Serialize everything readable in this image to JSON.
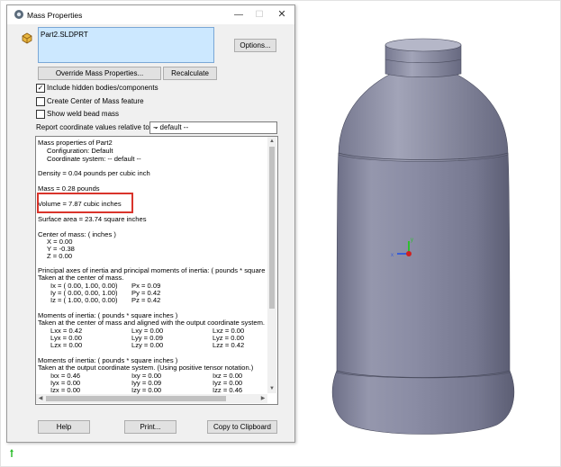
{
  "window": {
    "title": "Mass Properties",
    "minimize_glyph": "—",
    "maximize_glyph": "☐",
    "close_glyph": "✕"
  },
  "part": {
    "name": "Part2.SLDPRT"
  },
  "buttons": {
    "options": "Options...",
    "override": "Override Mass Properties...",
    "recalculate": "Recalculate",
    "help": "Help",
    "print": "Print...",
    "copy": "Copy to Clipboard"
  },
  "checkboxes": [
    {
      "label": "Include hidden bodies/components",
      "checked": true
    },
    {
      "label": "Create Center of Mass feature",
      "checked": false
    },
    {
      "label": "Show weld bead mass",
      "checked": false
    }
  ],
  "report": {
    "label": "Report coordinate values relative to:",
    "selected": "-- default --"
  },
  "results": {
    "header": "Mass properties of Part2",
    "configuration": "Configuration: Default",
    "coordinate_system": "Coordinate system: -- default --",
    "density": "Density = 0.04 pounds per cubic inch",
    "mass": "Mass = 0.28 pounds",
    "volume": "Volume = 7.87 cubic inches",
    "surface_area": "Surface area = 23.74 square inches",
    "com_title": "Center of mass: ( inches )",
    "com_x": "X = 0.00",
    "com_y": "Y = -0.38",
    "com_z": "Z = 0.00",
    "principal_title": "Principal axes of inertia and principal moments of inertia: ( pounds * square",
    "principal_sub": "Taken at the center of mass.",
    "principal_rows": [
      {
        "axis": "Ix = ( 0.00,  1.00,  0.00)",
        "moment": "Px = 0.09"
      },
      {
        "axis": "Iy = ( 0.00,  0.00,  1.00)",
        "moment": "Py = 0.42"
      },
      {
        "axis": "Iz = ( 1.00,  0.00,  0.00)",
        "moment": "Pz = 0.42"
      }
    ],
    "moi_com_title": "Moments of inertia: ( pounds * square inches )",
    "moi_com_sub": "Taken at the center of mass and aligned with the output coordinate system.",
    "moi_com_rows": [
      [
        "Lxx = 0.42",
        "Lxy = 0.00",
        "Lxz = 0.00"
      ],
      [
        "Lyx = 0.00",
        "Lyy = 0.09",
        "Lyz = 0.00"
      ],
      [
        "Lzx = 0.00",
        "Lzy = 0.00",
        "Lzz = 0.42"
      ]
    ],
    "moi_out_title": "Moments of inertia: ( pounds * square inches )",
    "moi_out_sub": "Taken at the output coordinate system. (Using positive tensor notation.)",
    "moi_out_rows": [
      [
        "Ixx = 0.46",
        "Ixy = 0.00",
        "Ixz = 0.00"
      ],
      [
        "Iyx = 0.00",
        "Iyy = 0.09",
        "Iyz = 0.00"
      ],
      [
        "Izx = 0.00",
        "Izy = 0.00",
        "Izz = 0.46"
      ]
    ]
  },
  "colors": {
    "highlight": "#d9342b",
    "selection": "#cce8ff",
    "bottle": "#8a8ca4"
  }
}
